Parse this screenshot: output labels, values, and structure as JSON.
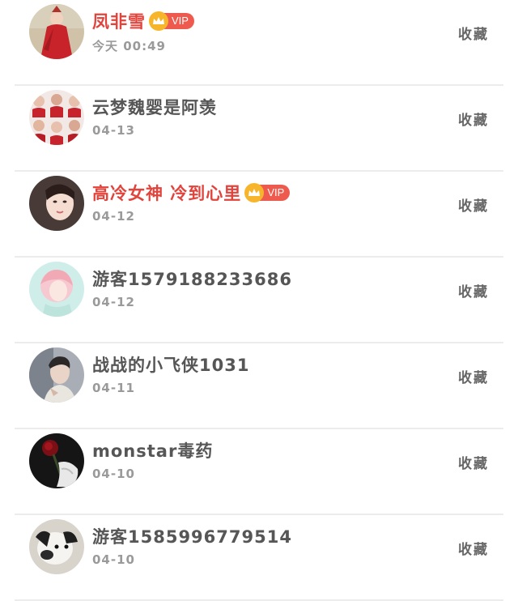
{
  "colors": {
    "vip_name": "#e0443d",
    "normal_name": "#565656",
    "date": "#9a9a9a",
    "action": "#666666",
    "vip_badge_bg": "#ee5b4e",
    "crown": "#f7b52c",
    "divider": "#ececec"
  },
  "rows": [
    {
      "name": "凤非雪",
      "vip": true,
      "vip_label": "VIP",
      "date": "今天 00:49",
      "action": "收藏",
      "avatar_icon": "avatar-woman-red-dress"
    },
    {
      "name": "云梦魏婴是阿羡",
      "vip": false,
      "date": "04-13",
      "action": "收藏",
      "avatar_icon": "avatar-photo-grid"
    },
    {
      "name": "高冷女神 冷到心里",
      "vip": true,
      "vip_label": "VIP",
      "date": "04-12",
      "action": "收藏",
      "avatar_icon": "avatar-woman-portrait"
    },
    {
      "name": "游客1579188233686",
      "vip": false,
      "date": "04-12",
      "action": "收藏",
      "avatar_icon": "avatar-pink-illustration"
    },
    {
      "name": "战战的小飞侠1031",
      "vip": false,
      "date": "04-11",
      "action": "收藏",
      "avatar_icon": "avatar-man-portrait"
    },
    {
      "name": "monstar毒药",
      "vip": false,
      "date": "04-10",
      "action": "收藏",
      "avatar_icon": "avatar-dark-rose"
    },
    {
      "name": "游客1585996779514",
      "vip": false,
      "date": "04-10",
      "action": "收藏",
      "avatar_icon": "avatar-dog"
    }
  ]
}
